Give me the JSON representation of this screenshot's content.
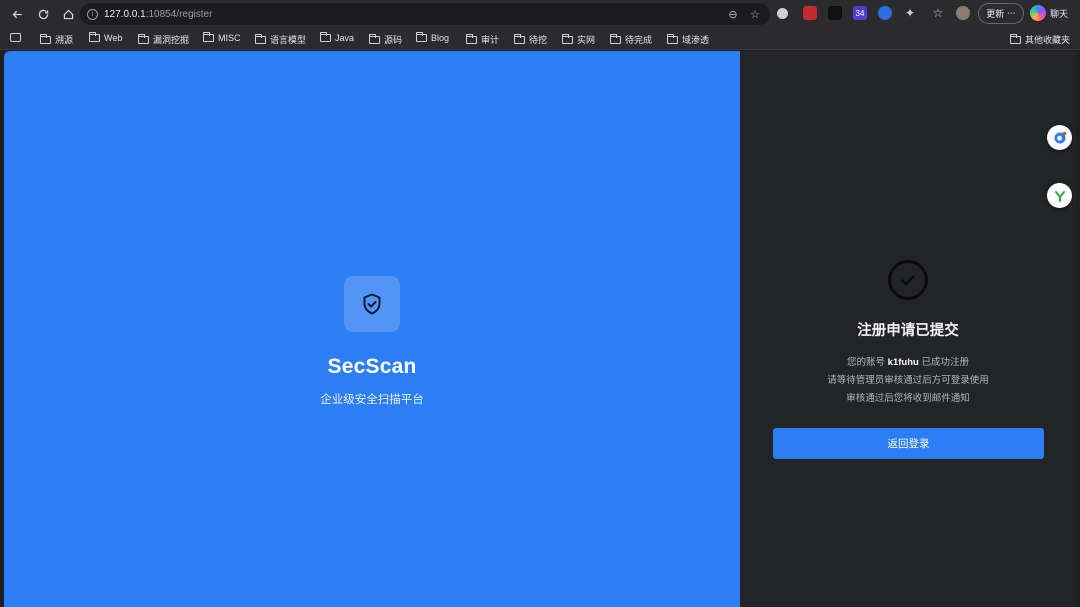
{
  "browser": {
    "url_host": "127.0.0.1",
    "url_path": ":10854/register",
    "update_label": "更新",
    "update_more": "⋯",
    "chat_label": "聊天",
    "extension_badge": "34"
  },
  "bookmarks": {
    "items": [
      "溯源",
      "Web",
      "漏洞挖掘",
      "MISC",
      "语言模型",
      "Java",
      "源码",
      "Blog",
      "审计",
      "待挖",
      "实网",
      "待完成",
      "域渗透"
    ],
    "other": "其他收藏夹"
  },
  "hero": {
    "brand": "SecScan",
    "tagline": "企业级安全扫描平台"
  },
  "panel": {
    "title": "注册申请已提交",
    "line1_prefix": "您的账号",
    "username": "k1fuhu",
    "line1_suffix": "已成功注册",
    "line2": "请等待管理员审核通过后方可登录使用",
    "line3": "审核通过后您将收到邮件通知",
    "back_button": "返回登录"
  },
  "colors": {
    "accent": "#2c7ef4",
    "panel_bg": "#232427"
  }
}
